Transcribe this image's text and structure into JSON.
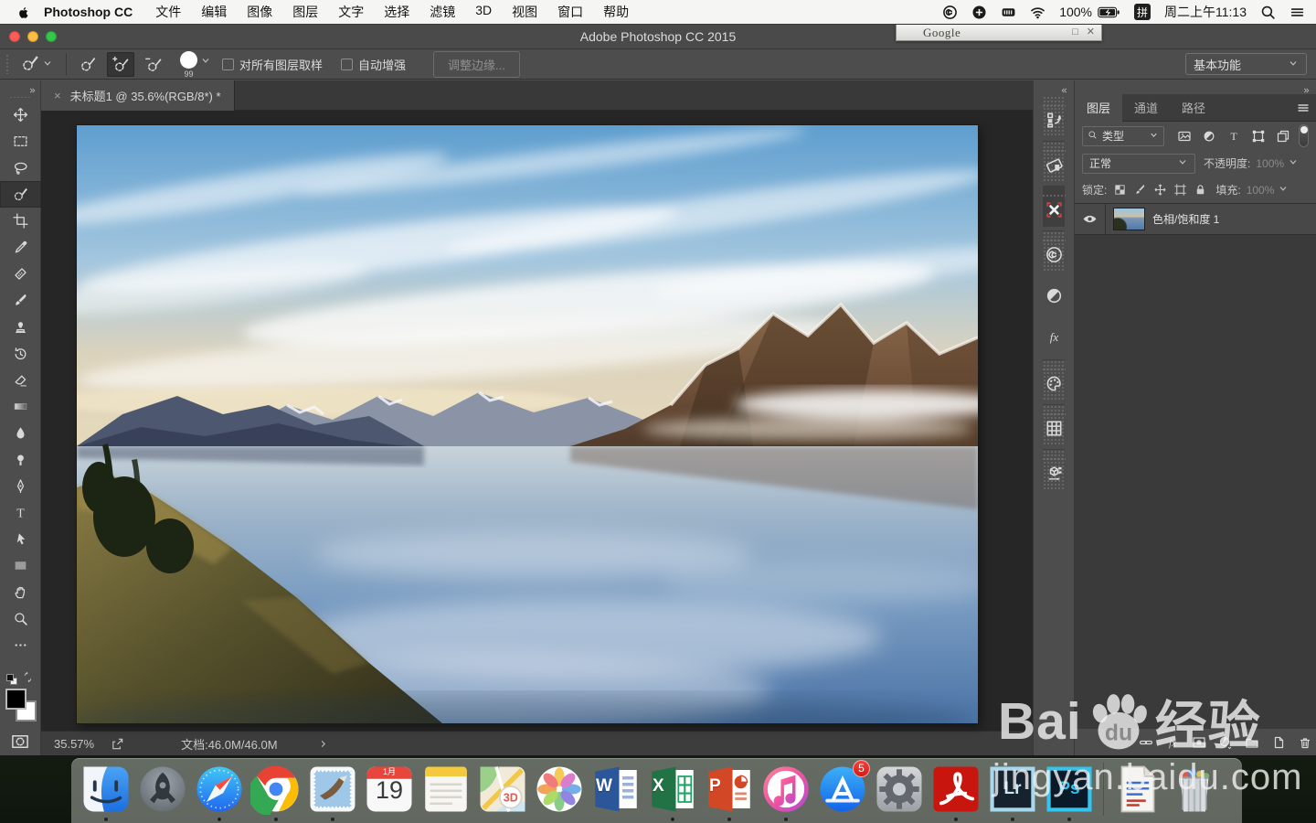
{
  "menu_bar": {
    "app_name": "Photoshop CC",
    "items": [
      "文件",
      "编辑",
      "图像",
      "图层",
      "文字",
      "选择",
      "滤镜",
      "3D",
      "视图",
      "窗口",
      "帮助"
    ],
    "battery_percent": "100%",
    "input_method": "拼",
    "clock": "周二上午11:13"
  },
  "window": {
    "title": "Adobe Photoshop CC 2015"
  },
  "google_window": {
    "title": "Google",
    "maximize_glyph": "□",
    "close_glyph": "✕"
  },
  "options_bar": {
    "modes": [
      {
        "id": "new-selection",
        "icon": "qs-new"
      },
      {
        "id": "add-to-selection",
        "icon": "qs-add",
        "cls": "active"
      },
      {
        "id": "subtract-from-selection",
        "icon": "qs-sub"
      }
    ],
    "brush_size": "99",
    "sample_all_layers_label": "对所有图层取样",
    "auto_enhance_label": "自动增强",
    "refine_edge_label": "调整边缘...",
    "workspace": "基本功能"
  },
  "document": {
    "tab_title": "未标题1 @ 35.6%(RGB/8*) *",
    "close_glyph": "×"
  },
  "tools": [
    {
      "id": "move",
      "icon": "move"
    },
    {
      "id": "marquee",
      "icon": "marquee"
    },
    {
      "id": "lasso",
      "icon": "lasso"
    },
    {
      "id": "quick-selection",
      "icon": "qs",
      "cls": "active"
    },
    {
      "id": "crop",
      "icon": "crop"
    },
    {
      "id": "eyedropper",
      "icon": "eyedropper"
    },
    {
      "id": "spot-healing-brush",
      "icon": "healing"
    },
    {
      "id": "brush",
      "icon": "brush"
    },
    {
      "id": "clone-stamp",
      "icon": "stamp"
    },
    {
      "id": "history-brush",
      "icon": "historybrush"
    },
    {
      "id": "eraser",
      "icon": "eraser"
    },
    {
      "id": "gradient",
      "icon": "gradienttool"
    },
    {
      "id": "blur",
      "icon": "blur"
    },
    {
      "id": "dodge",
      "icon": "dodge"
    },
    {
      "id": "pen",
      "icon": "pen"
    },
    {
      "id": "type",
      "icon": "typetool"
    },
    {
      "id": "path-selection",
      "icon": "pathselect"
    },
    {
      "id": "rectangle",
      "icon": "recttool"
    },
    {
      "id": "hand",
      "icon": "hand"
    },
    {
      "id": "zoom",
      "icon": "zoomtool"
    },
    {
      "id": "more-tools",
      "icon": "more"
    }
  ],
  "panel_dock": [
    {
      "id": "history",
      "icon": "p-history",
      "cls": "grip"
    },
    {
      "id": "device-preview",
      "icon": "p-device",
      "cls": "grip sep"
    },
    {
      "id": "properties",
      "icon": "p-xprops",
      "cls": "grip sep active"
    },
    {
      "id": "libraries",
      "icon": "p-cc",
      "cls": "grip sep"
    },
    {
      "id": "adjustments",
      "icon": "p-half",
      "cls": ""
    },
    {
      "id": "styles",
      "icon": "p-fx",
      "cls": ""
    },
    {
      "id": "color",
      "icon": "p-palette",
      "cls": "grip sep"
    },
    {
      "id": "swatches",
      "icon": "p-grid",
      "cls": "grip sep"
    },
    {
      "id": "3d",
      "icon": "p-cube",
      "cls": "grip sep"
    }
  ],
  "layers_panel": {
    "tabs": [
      {
        "label": "图层",
        "cls": "active"
      },
      {
        "label": "通道",
        "cls": ""
      },
      {
        "label": "路径",
        "cls": ""
      }
    ],
    "filter_label": "类型",
    "filter_icons": [
      {
        "id": "filter-pixel-layers",
        "icon": "f-img"
      },
      {
        "id": "filter-adjustment-layers",
        "icon": "f-half"
      },
      {
        "id": "filter-type-layers",
        "icon": "f-type"
      },
      {
        "id": "filter-shape-layers",
        "icon": "f-shape"
      },
      {
        "id": "filter-smart-objects",
        "icon": "f-smart"
      }
    ],
    "blend_mode": "正常",
    "opacity_label": "不透明度:",
    "opacity_value": "100%",
    "lock_label": "锁定:",
    "lock_icons": [
      {
        "id": "lock-transparency",
        "icon": "l-checker"
      },
      {
        "id": "lock-pixels",
        "icon": "l-brush"
      },
      {
        "id": "lock-position",
        "icon": "l-move"
      },
      {
        "id": "lock-artboard",
        "icon": "l-board"
      },
      {
        "id": "lock-all",
        "icon": "l-lock"
      }
    ],
    "fill_label": "填充:",
    "fill_value": "100%",
    "layers": [
      {
        "name": "色相/饱和度 1",
        "cls": "selected"
      }
    ],
    "bottom_icons": [
      {
        "id": "link-layers",
        "icon": "b-link"
      },
      {
        "id": "layer-style",
        "icon": "b-fx"
      },
      {
        "id": "add-layer-mask",
        "icon": "b-mask"
      },
      {
        "id": "new-adjustment-layer",
        "icon": "b-adj"
      },
      {
        "id": "new-group",
        "icon": "b-folder"
      },
      {
        "id": "new-layer",
        "icon": "b-new"
      },
      {
        "id": "delete-layer",
        "icon": "b-trash"
      }
    ]
  },
  "status_bar": {
    "zoom": "35.57%",
    "doc_info": "文档:46.0M/46.0M"
  },
  "dock": {
    "items": [
      {
        "id": "finder",
        "icon": "d-finder",
        "cls": "running"
      },
      {
        "id": "launchpad",
        "icon": "d-launchpad",
        "cls": ""
      },
      {
        "id": "safari",
        "icon": "d-safari",
        "cls": "running"
      },
      {
        "id": "chrome",
        "icon": "d-chrome",
        "cls": "running"
      },
      {
        "id": "mail",
        "icon": "d-mail",
        "cls": "running"
      },
      {
        "id": "calendar",
        "icon": "d-calendar",
        "cls": "calendar",
        "month": "1月",
        "day": "19"
      },
      {
        "id": "notes",
        "icon": "d-notes",
        "cls": ""
      },
      {
        "id": "maps",
        "icon": "d-maps",
        "cls": ""
      },
      {
        "id": "photos",
        "icon": "d-photos",
        "cls": ""
      },
      {
        "id": "word",
        "icon": "d-word",
        "cls": "office",
        "letter": "W"
      },
      {
        "id": "excel",
        "icon": "d-excel",
        "cls": "office running",
        "letter": "X"
      },
      {
        "id": "powerpoint",
        "icon": "d-powerpoint",
        "cls": "office running",
        "letter": "P"
      },
      {
        "id": "itunes",
        "icon": "d-itunes",
        "cls": "running"
      },
      {
        "id": "appstore",
        "icon": "d-appstore",
        "cls": "",
        "badge": "5"
      },
      {
        "id": "system-preferences",
        "icon": "d-sysprefs",
        "cls": ""
      },
      {
        "id": "acrobat",
        "icon": "d-acrobat",
        "cls": "running"
      },
      {
        "id": "lightroom",
        "icon": "d-lightroom",
        "cls": "lightroom running",
        "letter": "Lr"
      },
      {
        "id": "photoshop",
        "icon": "d-photoshop",
        "cls": "photoshop running",
        "letter": "Ps"
      },
      {
        "id": "divider",
        "cls": "divider"
      },
      {
        "id": "document",
        "icon": "d-document",
        "cls": ""
      },
      {
        "id": "trash",
        "icon": "d-trash",
        "cls": ""
      }
    ]
  },
  "watermark": {
    "brand_prefix": "Bai",
    "paw_text": "du",
    "brand_suffix": "经验",
    "url": "jingyan.baidu.com"
  }
}
